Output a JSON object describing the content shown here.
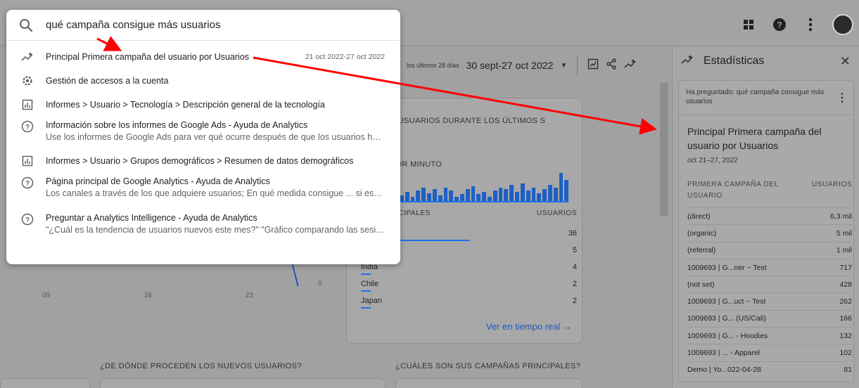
{
  "search": {
    "query": "qué campaña consigue más usuarios",
    "results": [
      {
        "icon": "insights-icon",
        "title": "Principal Primera campaña del usuario por Usuarios",
        "date": "21 oct 2022-27 oct 2022",
        "snippet": ""
      },
      {
        "icon": "gear-icon",
        "title": "Gestión de accesos a la cuenta",
        "date": "",
        "snippet": ""
      },
      {
        "icon": "report-icon",
        "title": "Informes > Usuario > Tecnología > Descripción general de la tecnología",
        "date": "",
        "snippet": ""
      },
      {
        "icon": "help-icon",
        "title": "Información sobre los informes de Google Ads - Ayuda de Analytics",
        "date": "",
        "snippet": "Use los informes de Google Ads para ver qué ocurre después de que los usuarios hag..."
      },
      {
        "icon": "report-icon",
        "title": "Informes > Usuario > Grupos demográficos > Resumen de datos demográficos",
        "date": "",
        "snippet": ""
      },
      {
        "icon": "help-icon",
        "title": "Página principal de Google Analytics - Ayuda de Analytics",
        "date": "",
        "snippet": "Los canales a través de los que adquiere usuarios; En qué medida consigue ... si está l..."
      },
      {
        "icon": "help-icon",
        "title": "Preguntar a Analytics Intelligence - Ayuda de Analytics",
        "date": "",
        "snippet": "\"¿Cuál es la tendencia de usuarios nuevos este mes?\" \"Gráfico comparando las sesion..."
      }
    ]
  },
  "daterange": {
    "prefix": "los últimos 28 días",
    "value": "30 sept-27 oct 2022"
  },
  "realtime": {
    "title": "E USUARIOS DURANTE LOS ÚLTIMOS S",
    "subtitle": "POR MINUTO",
    "bars": [
      4,
      7,
      3,
      8,
      10,
      6,
      9,
      4,
      10,
      8,
      3,
      5,
      9,
      11,
      5,
      7,
      3,
      8,
      10,
      9,
      12,
      7,
      13,
      8,
      10,
      6,
      9,
      12,
      10,
      21,
      16
    ],
    "col_country": "INCIPALES",
    "col_users": "USUARIOS",
    "rows": [
      {
        "name": "es",
        "value": "36"
      },
      {
        "name": "",
        "value": "5"
      },
      {
        "name": "India",
        "value": "4"
      },
      {
        "name": "Chile",
        "value": "2"
      },
      {
        "name": "Japan",
        "value": "2"
      }
    ],
    "link": "Ver en tiempo real →"
  },
  "chart": {
    "axis": [
      "09",
      "16",
      "23"
    ],
    "zero": "0"
  },
  "bottom": {
    "head1": "¿DE DÓNDE PROCEDEN LOS NUEVOS USUARIOS?",
    "head2": "¿CUÁLES SON SUS CAMPAÑAS PRINCIPALES?"
  },
  "panel": {
    "title": "Estadísticas",
    "asked": "Ha preguntado: qué campaña consigue más usuarios",
    "answer_title": "Principal Primera campaña del usuario por Usuarios",
    "answer_date": "oct 21–27, 2022",
    "col_campaign": "PRIMERA CAMPAÑA DEL USUARIO",
    "col_users": "USUARIOS",
    "rows": [
      {
        "name": "(direct)",
        "value": "6,3 mil"
      },
      {
        "name": "(organic)",
        "value": "5 mil"
      },
      {
        "name": "(referral)",
        "value": "1 mil"
      },
      {
        "name": "1009693 | G...ner ~ Test",
        "value": "717"
      },
      {
        "name": "(not set)",
        "value": "428"
      },
      {
        "name": "1009693 | G...uct ~ Test",
        "value": "262"
      },
      {
        "name": "1009693 | G... (US/Cali)",
        "value": "166"
      },
      {
        "name": "1009693 | G... - Hoodies",
        "value": "132"
      },
      {
        "name": "1009693 | ... - Apparel",
        "value": "102"
      },
      {
        "name": "Demo | Yo...022-04-28",
        "value": "81"
      }
    ]
  },
  "colors": {
    "arrow": "#ff0000",
    "link": "#1a73e8"
  }
}
